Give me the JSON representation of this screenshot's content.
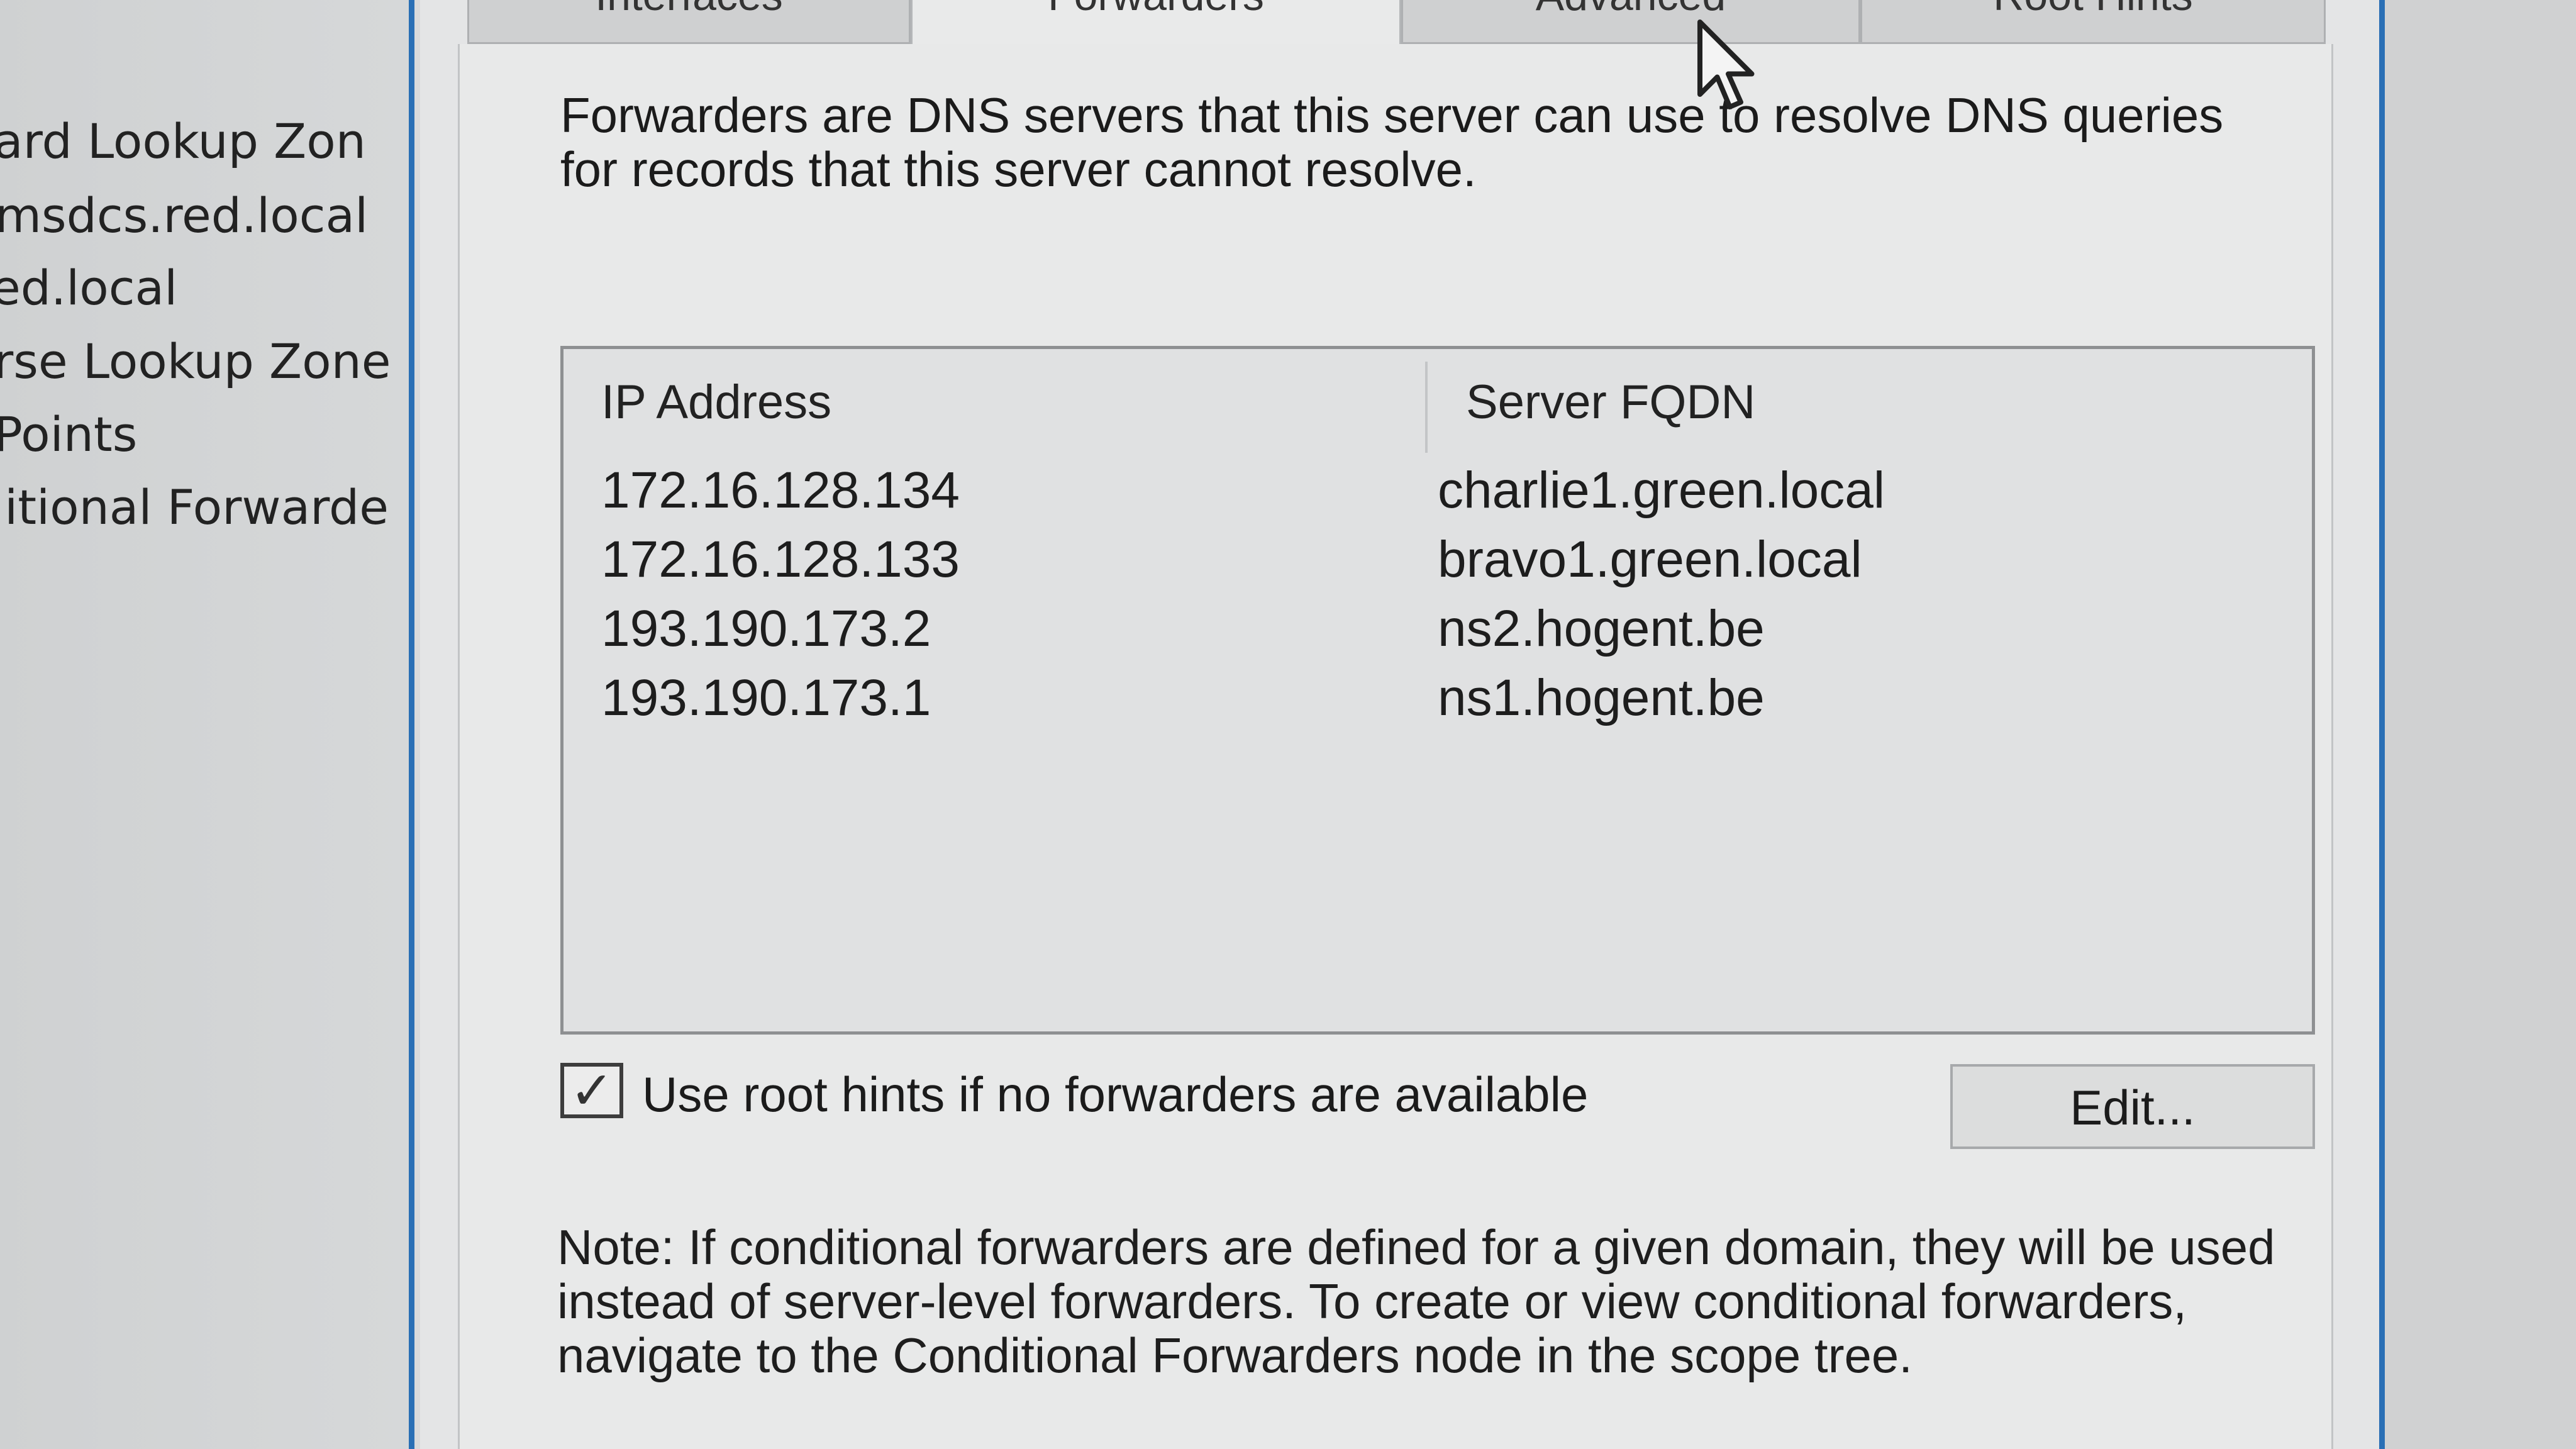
{
  "scope_tree": {
    "items": [
      "ard Lookup Zon",
      "msdcs.red.local",
      "ed.local",
      "rse Lookup Zone",
      " Points",
      "litional Forwarde"
    ]
  },
  "dialog": {
    "tabs": [
      "Interfaces",
      "Forwarders",
      "Advanced",
      "Root Hints"
    ],
    "active_tab": "Forwarders",
    "description": "Forwarders are DNS servers that this server can use to resolve DNS queries for records that this server cannot resolve.",
    "forwarders_table": {
      "columns": [
        "IP Address",
        "Server FQDN"
      ],
      "rows": [
        {
          "ip": "172.16.128.134",
          "fqdn": "charlie1.green.local"
        },
        {
          "ip": "172.16.128.133",
          "fqdn": "bravo1.green.local"
        },
        {
          "ip": "193.190.173.2",
          "fqdn": "ns2.hogent.be"
        },
        {
          "ip": "193.190.173.1",
          "fqdn": "ns1.hogent.be"
        }
      ]
    },
    "root_hints_checkbox": {
      "label": "Use root hints if no forwarders are available",
      "checked": true
    },
    "edit_button_label": "Edit...",
    "note": "Note: If conditional forwarders are defined for a given domain, they will be used instead of server-level forwarders.  To create or view conditional forwarders, navigate to the Conditional Forwarders node in the scope tree."
  },
  "colors": {
    "frame_blue": "#2a6fb5",
    "dialog_bg": "#e4e5e6",
    "list_border": "#8e9092"
  },
  "cursor": {
    "icon": "mouse-pointer-icon"
  }
}
